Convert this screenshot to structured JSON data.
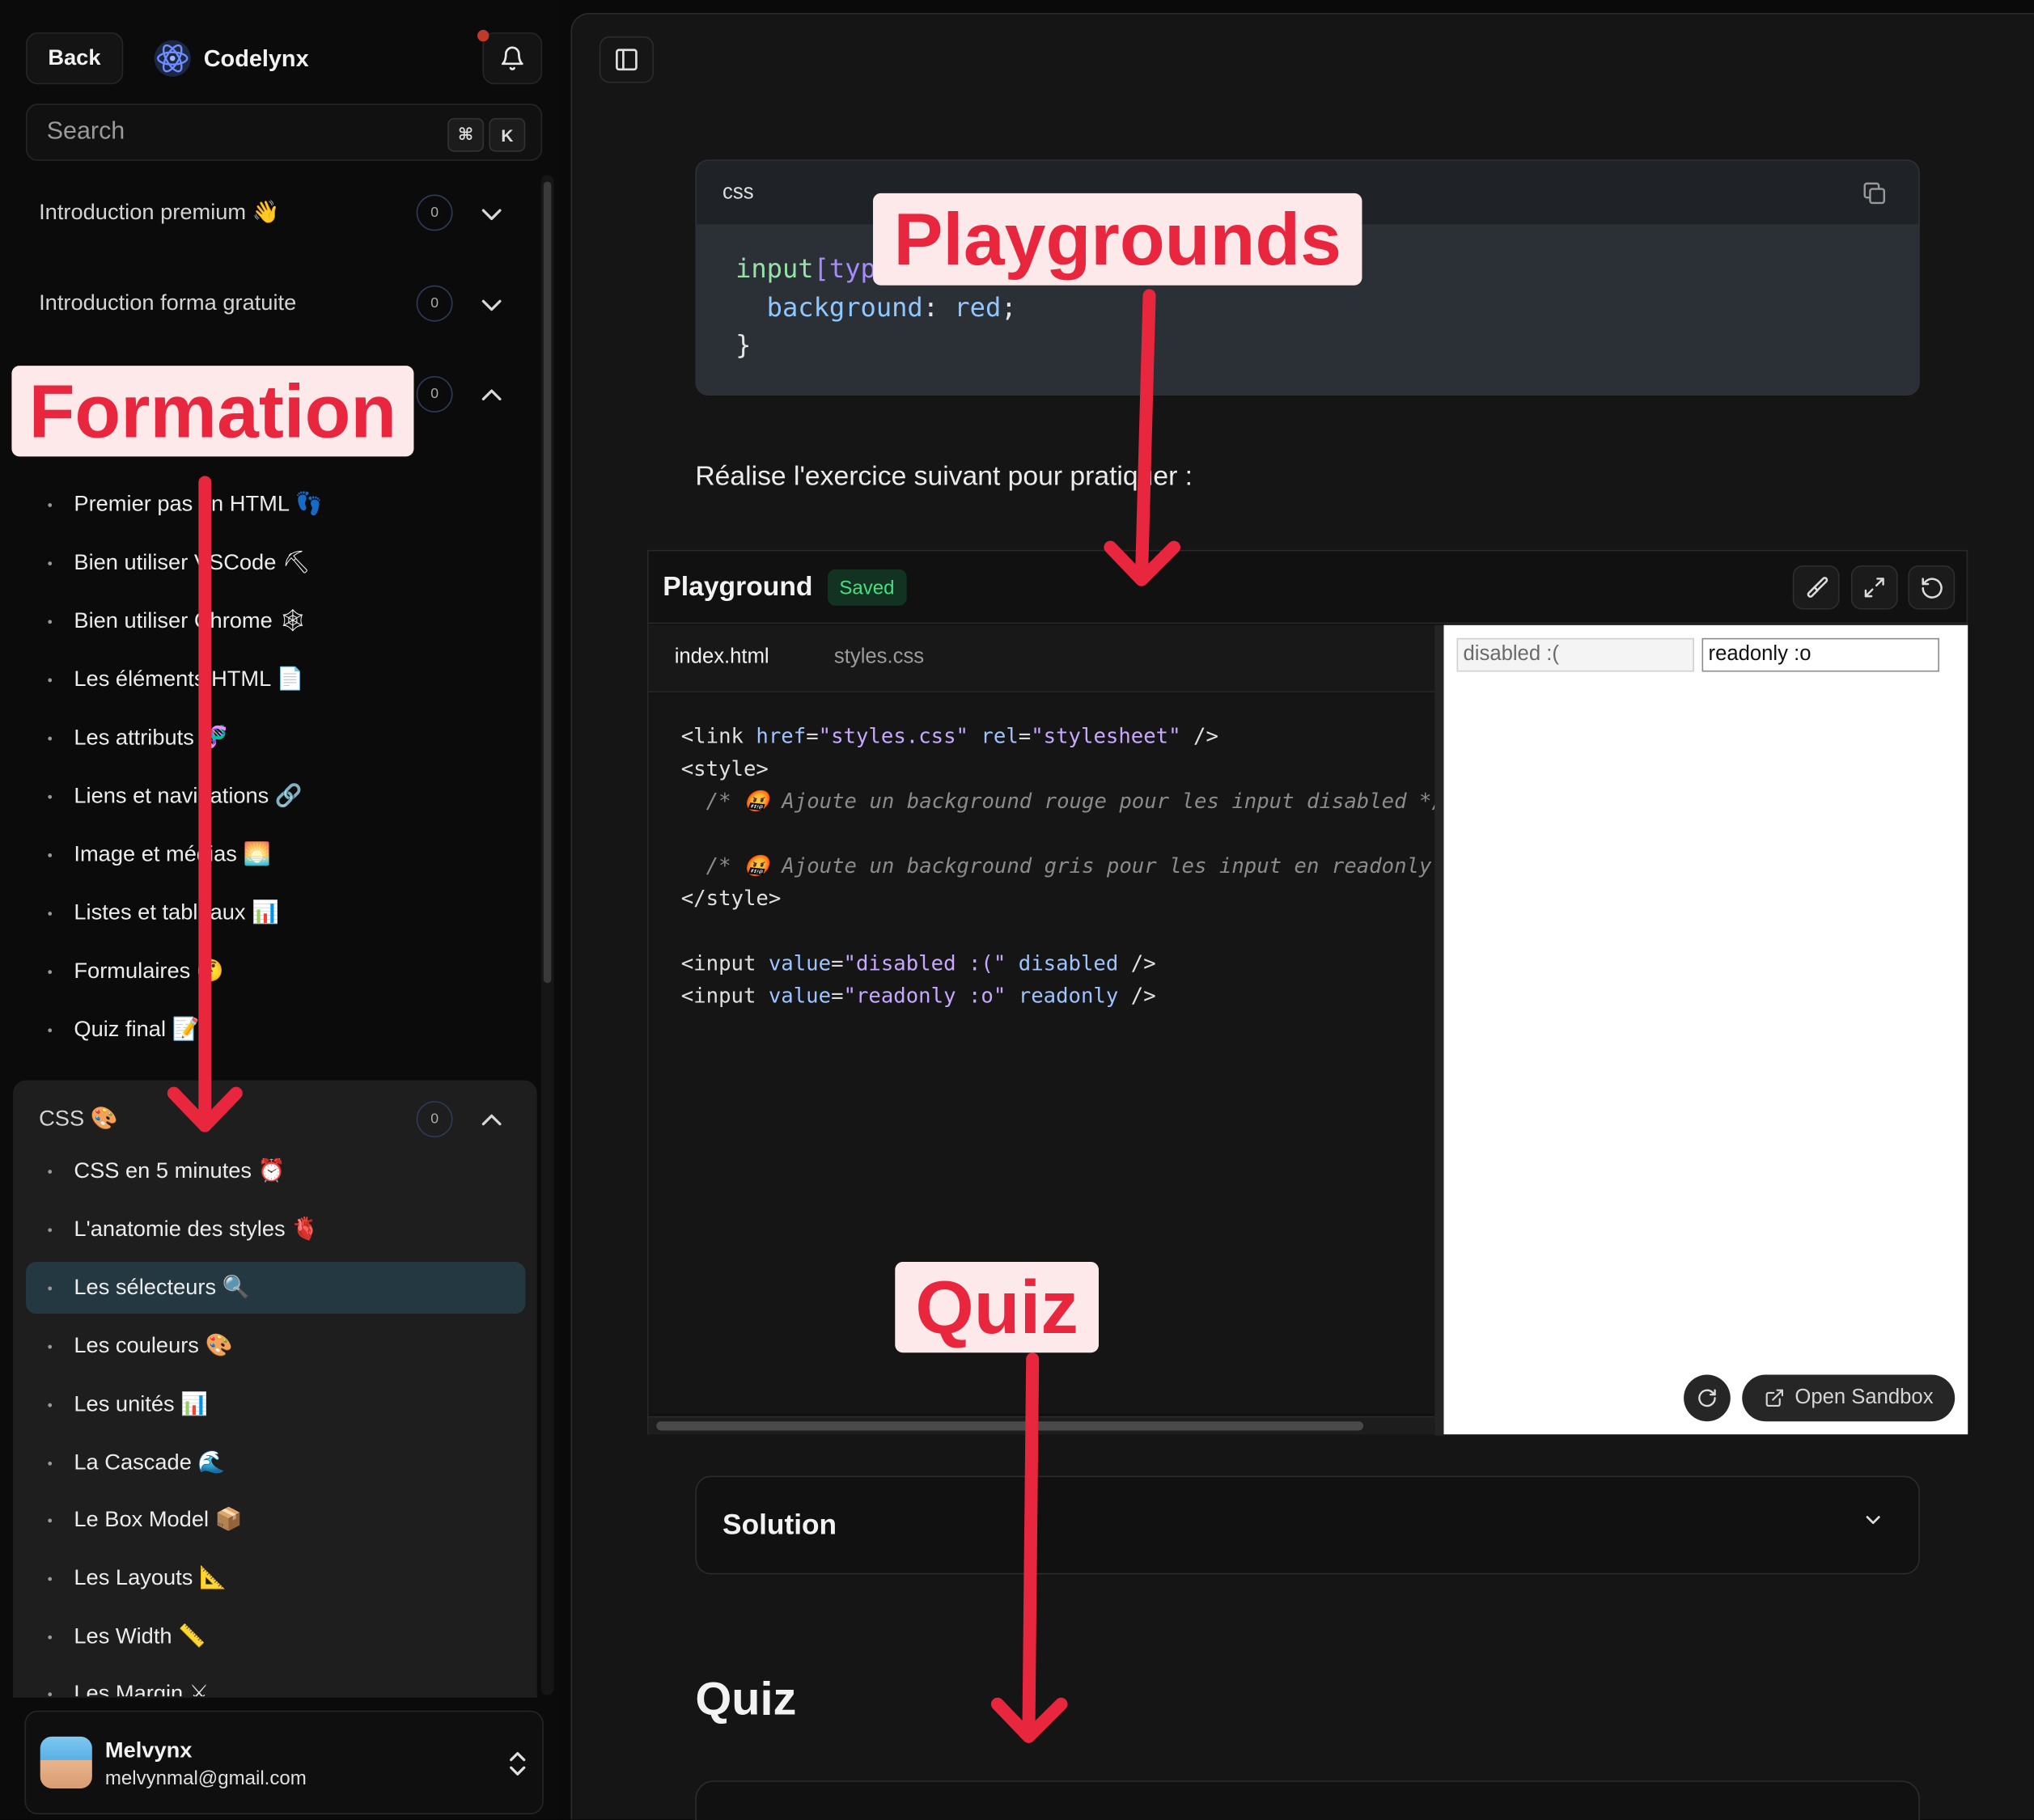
{
  "header": {
    "back_label": "Back",
    "app_name": "Codelynx"
  },
  "search": {
    "placeholder": "Search",
    "shortcut_cmd": "⌘",
    "shortcut_key": "K"
  },
  "sidebar": {
    "sections": [
      {
        "label": "Introduction premium 👋",
        "count": "0",
        "expanded": false
      },
      {
        "label": "Introduction forma gratuite",
        "count": "0",
        "expanded": false
      },
      {
        "label": "",
        "count": "0",
        "expanded": true
      }
    ],
    "html_items": [
      "Premier pas en HTML 👣",
      "Bien utiliser VSCode ⛏",
      "Bien utiliser Chrome 🕸",
      "Les éléments HTML 📄",
      "Les attributs 🧬",
      "Liens et navigations 🔗",
      "Image et médias 🌅",
      "Listes et tableaux 📊",
      "Formulaires 🤔",
      "Quiz final 📝"
    ],
    "css_section": {
      "label": "CSS 🎨",
      "count": "0"
    },
    "css_items": [
      "CSS en 5 minutes ⏰",
      "L'anatomie des styles 🫀",
      "Les sélecteurs 🔍",
      "Les couleurs 🎨",
      "Les unités 📊",
      "La Cascade 🌊",
      "Le Box Model 📦",
      "Les Layouts 📐",
      "Les Width 📏",
      "Les Margin ⚔"
    ],
    "active_item": "Les sélecteurs 🔍"
  },
  "user": {
    "name": "Melvynx",
    "email": "melvynmal@gmail.com"
  },
  "main": {
    "code_lang": "css",
    "code_lines": {
      "l1a": "input",
      "l1b": "[typ",
      "l2a": "  background",
      "l2b": ": ",
      "l2c": "red",
      "l2d": ";",
      "l3": "}"
    },
    "paragraph": "Réalise l'exercice suivant pour pratiquer :",
    "playground": {
      "title": "Playground",
      "status": "Saved",
      "tabs": [
        "index.html",
        "styles.css"
      ],
      "preview_disabled_value": "disabled :(",
      "preview_readonly_value": "readonly :o",
      "open_sandbox": "Open Sandbox"
    },
    "solution_label": "Solution",
    "quiz_heading": "Quiz"
  },
  "editor": {
    "link_tag": "<link",
    "link_href_attr": " href",
    "link_href_val": "\"styles.css\"",
    "link_rel_attr": " rel",
    "link_rel_val": "\"stylesheet\"",
    "link_close": " />",
    "style_open": "<style>",
    "comment1": "  /* 🤬 Ajoute un background rouge pour les input disabled */",
    "comment2": "  /* 🤬 Ajoute un background gris pour les input en readonly */",
    "style_close": "</style>",
    "input_tag": "<input",
    "value_attr": " value",
    "input1_value": "\"disabled :(\"",
    "input1_flag": " disabled",
    "input2_value": "\"readonly :o\"",
    "input2_flag": " readonly",
    "self_close": " />"
  },
  "annotations": {
    "formation": "Formation",
    "playgrounds": "Playgrounds",
    "quiz": "Quiz"
  },
  "colors": {
    "annotation_red": "#e8263e",
    "annotation_bg": "#fde8ea",
    "saved_green": "#4ade80",
    "active_item_bg": "#243842"
  }
}
